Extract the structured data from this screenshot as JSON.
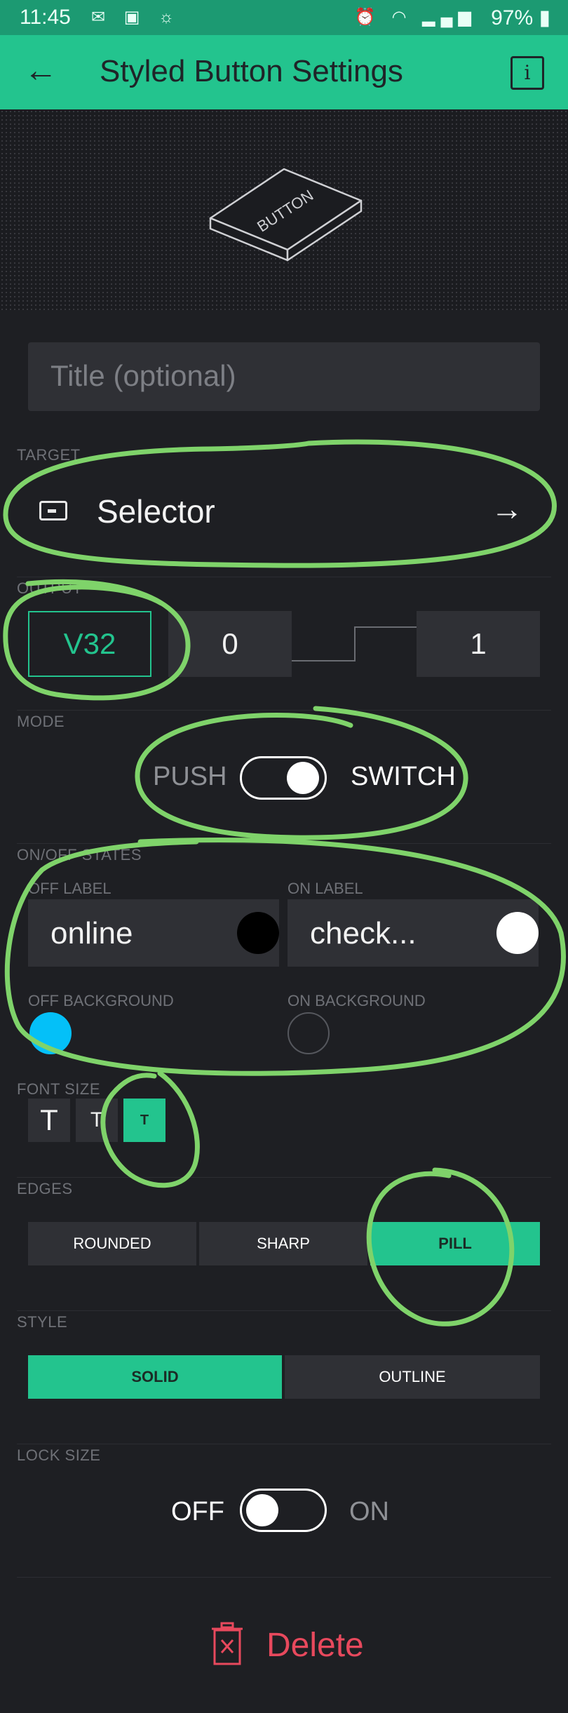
{
  "status_bar": {
    "time": "11:45",
    "battery": "97%"
  },
  "header": {
    "title": "Styled Button Settings",
    "info_label": "i"
  },
  "hero": {
    "label": "BUTTON"
  },
  "title_field": {
    "placeholder": "Title (optional)"
  },
  "target": {
    "label": "TARGET",
    "value": "Selector"
  },
  "output": {
    "label": "OUTPUT",
    "pin": "V32",
    "off_value": "0",
    "on_value": "1"
  },
  "mode": {
    "label": "MODE",
    "left": "PUSH",
    "right": "SWITCH",
    "switch_on": true
  },
  "states": {
    "label": "ON/OFF STATES",
    "off_label_title": "OFF LABEL",
    "off_label_value": "online",
    "on_label_title": "ON LABEL",
    "on_label_value": "check...",
    "off_bg_title": "OFF BACKGROUND",
    "on_bg_title": "ON BACKGROUND",
    "off_label_color": "#000000",
    "on_label_color": "#ffffff",
    "off_bg_color": "#04c0f8",
    "on_bg_color": "#1e1f23"
  },
  "font_size": {
    "label": "FONT SIZE",
    "options": [
      "T",
      "T",
      "T"
    ],
    "selected": 2
  },
  "edges": {
    "label": "EDGES",
    "options": [
      "ROUNDED",
      "SHARP",
      "PILL"
    ],
    "selected": "PILL"
  },
  "style": {
    "label": "STYLE",
    "options": [
      "SOLID",
      "OUTLINE"
    ],
    "selected": "SOLID"
  },
  "lock_size": {
    "label": "LOCK SIZE",
    "off": "OFF",
    "on": "ON",
    "enabled": false
  },
  "delete": {
    "label": "Delete"
  },
  "colors": {
    "accent": "#23c48e",
    "status_bar": "#1c9a72",
    "background": "#1e1f23",
    "delete": "#e8495d",
    "annotation": "#7fd36a"
  }
}
